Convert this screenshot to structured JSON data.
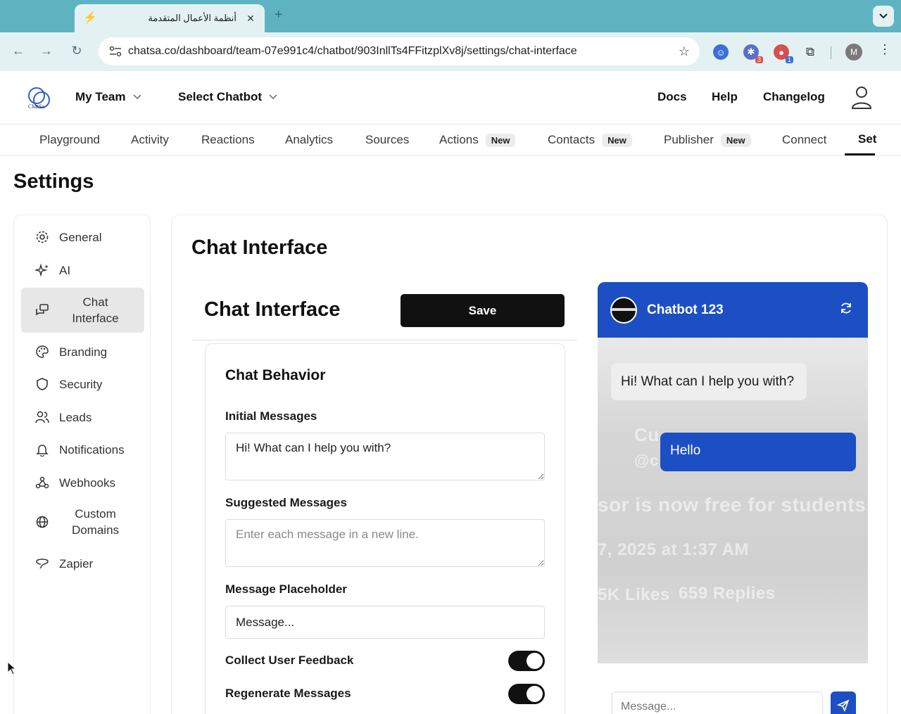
{
  "browser": {
    "tab_title": "أنظمة الأعمال المتقدمة",
    "url": "chatsa.co/dashboard/team-07e991c4/chatbot/903InllTs4FFitzplXv8j/settings/chat-interface",
    "ext_badges": [
      "3",
      "1"
    ],
    "profile_initial": "M"
  },
  "header": {
    "logo_text": "ChatSa",
    "team": "My Team",
    "chatbot": "Select Chatbot",
    "links": [
      "Docs",
      "Help",
      "Changelog"
    ]
  },
  "tabs": [
    {
      "label": "Playground",
      "badge": ""
    },
    {
      "label": "Activity",
      "badge": ""
    },
    {
      "label": "Reactions",
      "badge": ""
    },
    {
      "label": "Analytics",
      "badge": ""
    },
    {
      "label": "Sources",
      "badge": ""
    },
    {
      "label": "Actions",
      "badge": "New"
    },
    {
      "label": "Contacts",
      "badge": "New"
    },
    {
      "label": "Publisher",
      "badge": "New"
    },
    {
      "label": "Connect",
      "badge": ""
    },
    {
      "label": "Set",
      "badge": ""
    }
  ],
  "page_title": "Settings",
  "sidebar": {
    "items": [
      {
        "label": "General",
        "icon": "gear-icon"
      },
      {
        "label": "AI",
        "icon": "sparkles-icon"
      },
      {
        "label": "Chat Interface",
        "icon": "chat-icon"
      },
      {
        "label": "Branding",
        "icon": "palette-icon"
      },
      {
        "label": "Security",
        "icon": "shield-icon"
      },
      {
        "label": "Leads",
        "icon": "users-icon"
      },
      {
        "label": "Notifications",
        "icon": "bell-icon"
      },
      {
        "label": "Webhooks",
        "icon": "webhook-icon"
      },
      {
        "label": "Custom Domains",
        "icon": "globe-icon"
      },
      {
        "label": "Zapier",
        "icon": "zapier-icon"
      }
    ]
  },
  "main": {
    "title": "Chat Interface",
    "subtitle": "Chat Interface",
    "save_label": "Save",
    "behavior": {
      "title": "Chat Behavior",
      "initial_messages_label": "Initial Messages",
      "initial_messages_value": "Hi! What can I help you with?",
      "suggested_messages_label": "Suggested Messages",
      "suggested_messages_placeholder": "Enter each message in a new line.",
      "placeholder_label": "Message Placeholder",
      "placeholder_value": "Message...",
      "collect_feedback_label": "Collect User Feedback",
      "regenerate_label": "Regenerate Messages"
    }
  },
  "preview": {
    "bot_name": "Chatbot 123",
    "bot_message": "Hi! What can I help you with?",
    "user_message": "Hello",
    "input_placeholder": "Message...",
    "background_text": [
      "Cu",
      "@c",
      "sor is now free for students. Enj",
      "7, 2025 at 1:37 AM",
      "5K Likes",
      "659 Replies"
    ]
  },
  "colors": {
    "accent": "#1c4fc4",
    "tab_bar": "#5fb3c0",
    "toolbar": "#e3f1f3"
  }
}
